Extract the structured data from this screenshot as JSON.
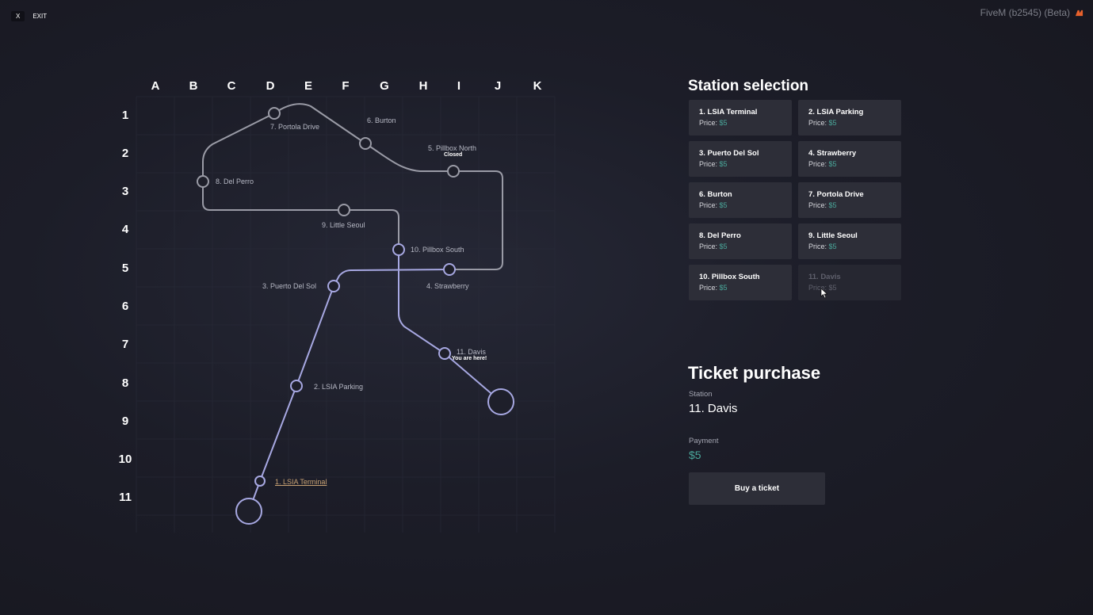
{
  "topbar": {
    "exit_key": "X",
    "exit_label": "EXIT",
    "app_title": "FiveM (b2545) (Beta)"
  },
  "grid": {
    "columns": [
      "A",
      "B",
      "C",
      "D",
      "E",
      "F",
      "G",
      "H",
      "I",
      "J",
      "K"
    ],
    "rows": [
      "1",
      "2",
      "3",
      "4",
      "5",
      "6",
      "7",
      "8",
      "9",
      "10",
      "11"
    ]
  },
  "map": {
    "stations": {
      "s1": "1. LSIA Terminal",
      "s2": "2. LSIA Parking",
      "s3": "3. Puerto Del Sol",
      "s4": "4. Strawberry",
      "s5": "5. Pillbox North",
      "s5_status": "Closed",
      "s6": "6. Burton",
      "s7": "7. Portola Drive",
      "s8": "8. Del Perro",
      "s9": "9. Little Seoul",
      "s10": "10. Pillbox South",
      "s11": "11. Davis",
      "s11_status": "You are here!"
    },
    "colors": {
      "route_active": "#a7a8e2",
      "route_inactive": "#9a9ba6",
      "current_station": "#c8a274"
    }
  },
  "selection": {
    "title": "Station selection",
    "price_label": "Price:",
    "cards": [
      {
        "name": "1. LSIA Terminal",
        "price": "$5"
      },
      {
        "name": "2. LSIA Parking",
        "price": "$5"
      },
      {
        "name": "3. Puerto Del Sol",
        "price": "$5"
      },
      {
        "name": "4. Strawberry",
        "price": "$5"
      },
      {
        "name": "6. Burton",
        "price": "$5"
      },
      {
        "name": "7. Portola Drive",
        "price": "$5"
      },
      {
        "name": "8. Del Perro",
        "price": "$5"
      },
      {
        "name": "9. Little Seoul",
        "price": "$5"
      },
      {
        "name": "10. Pillbox South",
        "price": "$5"
      },
      {
        "name": "11. Davis",
        "price": "$5",
        "disabled": true
      }
    ]
  },
  "ticket": {
    "title": "Ticket purchase",
    "station_label": "Station",
    "station_value": "11. Davis",
    "payment_label": "Payment",
    "payment_value": "$5",
    "buy_label": "Buy a ticket"
  }
}
